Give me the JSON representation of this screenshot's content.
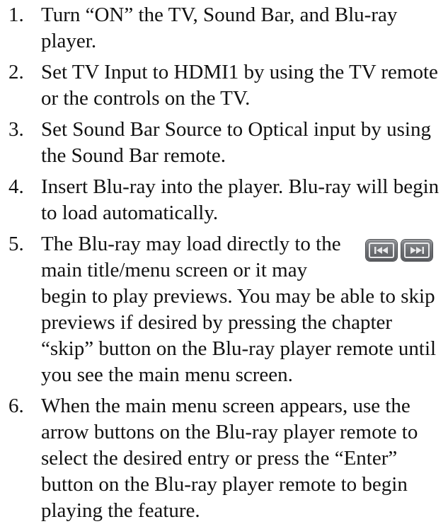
{
  "steps": [
    {
      "num": "1.",
      "text": "Turn “ON” the TV, Sound Bar, and Blu-ray player."
    },
    {
      "num": "2.",
      "text": "Set TV Input to HDMI1 by using the TV remote or the controls on the TV."
    },
    {
      "num": "3.",
      "text": "Set Sound Bar Source to Optical input by using the Sound Bar remote."
    },
    {
      "num": "4.",
      "text": "Insert Blu-ray into the player. Blu-ray will begin to load automatically."
    },
    {
      "num": "5.",
      "text": "The Blu-ray may load directly to the main title/menu screen or it may begin to play previews. You may be able to skip previews if desired by pressing the chapter “skip” button on the Blu-ray player remote until you see the main menu screen.",
      "icons": [
        "skip-previous-icon",
        "skip-next-icon"
      ]
    },
    {
      "num": "6.",
      "text": "When the main menu screen appears, use the arrow buttons on the Blu-ray player remote to select the desired entry or press the “Enter” button on the Blu-ray player remote to begin playing the feature."
    }
  ]
}
